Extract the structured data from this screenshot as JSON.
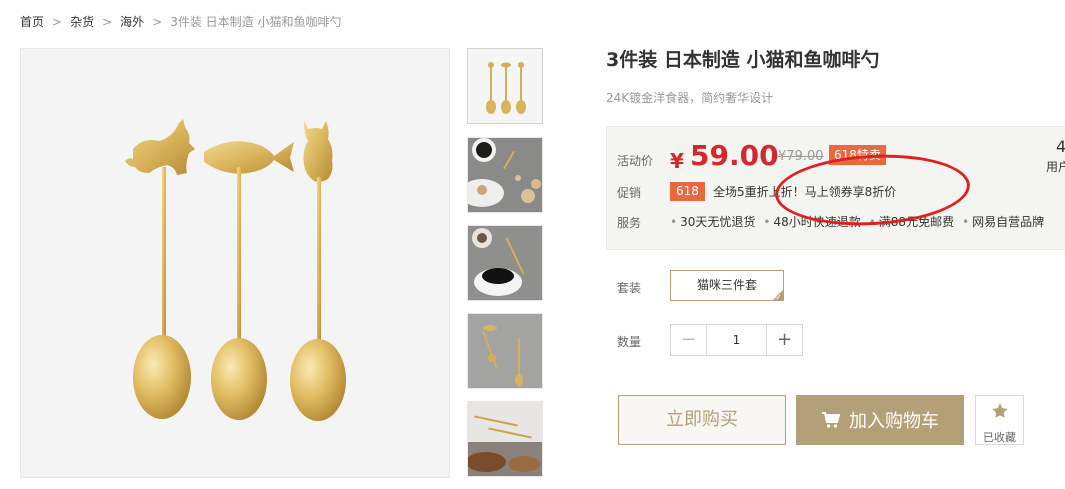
{
  "breadcrumb": {
    "items": [
      "首页",
      "杂货",
      "海外"
    ],
    "current": "3件装 日本制造 小猫和鱼咖啡勺"
  },
  "product": {
    "title": "3件装 日本制造 小猫和鱼咖啡勺",
    "subtitle": "24K镀金洋食器，简约奢华设计"
  },
  "price_box": {
    "activity_label": "活动价",
    "currency": "¥",
    "price": "59.00",
    "original_price": "¥79.00",
    "promo_tag": "618特卖",
    "right_number": "4",
    "right_text": "用户",
    "promo_label": "促销",
    "promo_badge": "618",
    "promo_text": "全场5重折上折！马上领券享8折价",
    "service_label": "服务",
    "services": [
      "30天无忧退货",
      "48小时快速退款",
      "满88元免邮费",
      "网易自营品牌"
    ]
  },
  "sku": {
    "label": "套装",
    "option": "猫咪三件套"
  },
  "quantity": {
    "label": "数量",
    "minus": "−",
    "value": "1",
    "plus": "+"
  },
  "actions": {
    "buy_now": "立即购买",
    "add_cart": "加入购物车",
    "favorite": "已收藏"
  },
  "colors": {
    "accent_gold": "#b4a078",
    "price_red": "#d4282d",
    "promo_orange": "#e8693d",
    "annotation_red": "#e02020"
  },
  "icons": {
    "breadcrumb_separator": "chevron-right-icon",
    "cart": "cart-icon",
    "favorite": "star-icon"
  }
}
